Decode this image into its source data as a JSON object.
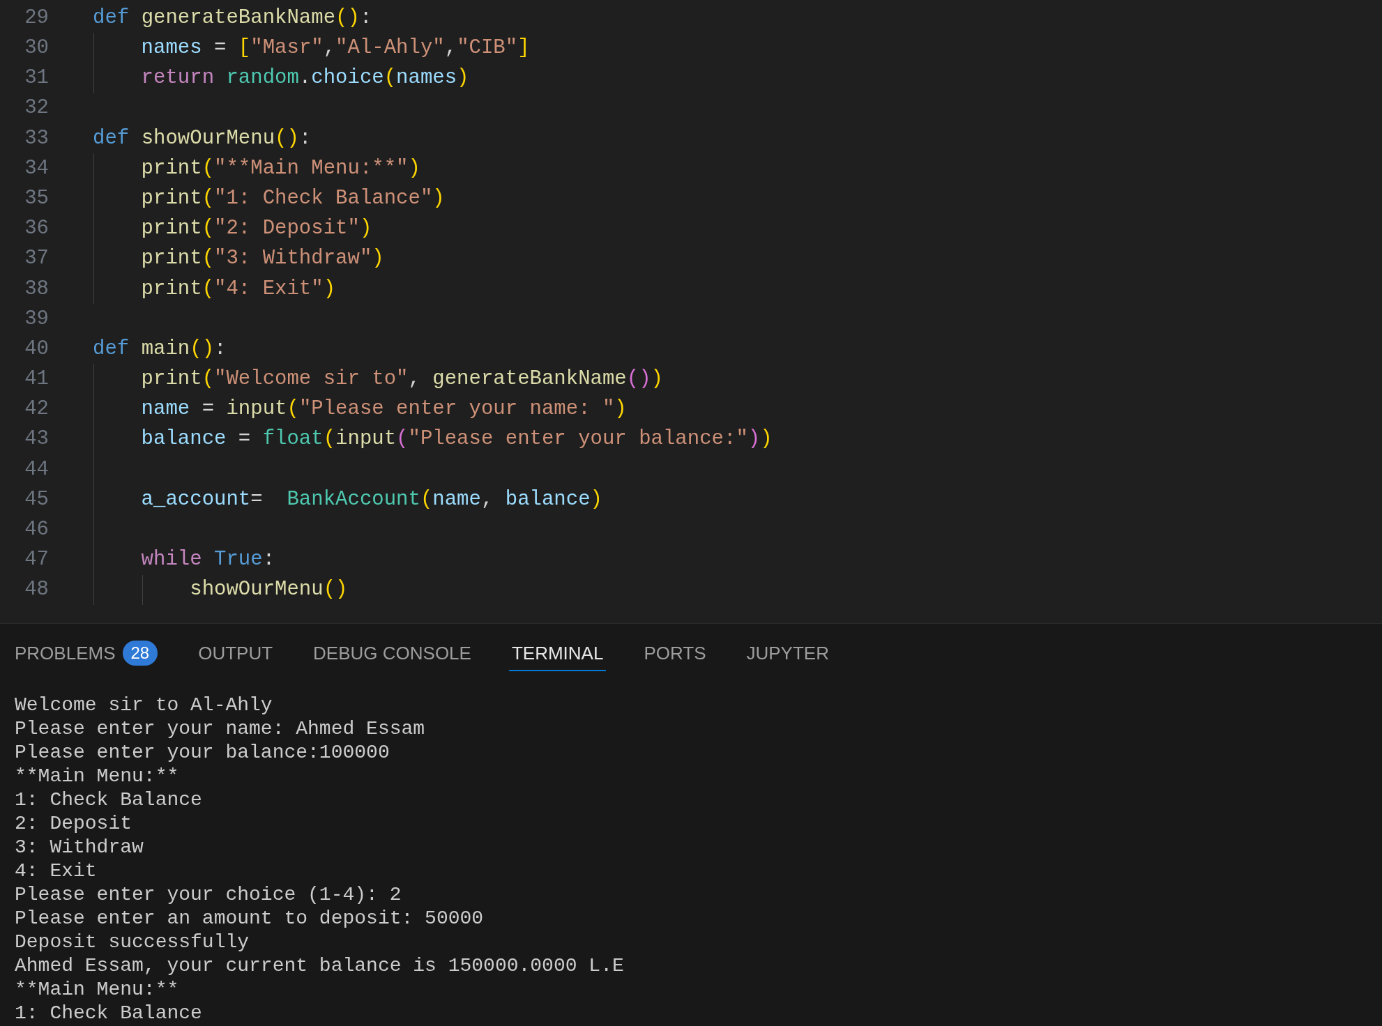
{
  "editor": {
    "lines": [
      {
        "number": "29",
        "tokens": [
          {
            "kind": "kw",
            "text": "def "
          },
          {
            "kind": "fn",
            "text": "generateBankName"
          },
          {
            "kind": "b1",
            "text": "()"
          },
          {
            "kind": "plain",
            "text": ":"
          }
        ]
      },
      {
        "number": "30",
        "tokens": [
          {
            "kind": "var",
            "text": "    names"
          },
          {
            "kind": "plain",
            "text": " = "
          },
          {
            "kind": "b1",
            "text": "["
          },
          {
            "kind": "str",
            "text": "\"Masr\""
          },
          {
            "kind": "plain",
            "text": ","
          },
          {
            "kind": "str",
            "text": "\"Al-Ahly\""
          },
          {
            "kind": "plain",
            "text": ","
          },
          {
            "kind": "str",
            "text": "\"CIB\""
          },
          {
            "kind": "b1",
            "text": "]"
          }
        ]
      },
      {
        "number": "31",
        "tokens": [
          {
            "kind": "ctrl",
            "text": "    return "
          },
          {
            "kind": "cls",
            "text": "random"
          },
          {
            "kind": "plain",
            "text": "."
          },
          {
            "kind": "var",
            "text": "choice"
          },
          {
            "kind": "b1",
            "text": "("
          },
          {
            "kind": "var",
            "text": "names"
          },
          {
            "kind": "b1",
            "text": ")"
          }
        ]
      },
      {
        "number": "32"
      },
      {
        "number": "33",
        "tokens": [
          {
            "kind": "kw",
            "text": "def "
          },
          {
            "kind": "fn",
            "text": "showOurMenu"
          },
          {
            "kind": "b1",
            "text": "()"
          },
          {
            "kind": "plain",
            "text": ":"
          }
        ]
      },
      {
        "number": "34",
        "tokens": [
          {
            "kind": "fn",
            "text": "    print"
          },
          {
            "kind": "b1",
            "text": "("
          },
          {
            "kind": "str",
            "text": "\"**Main Menu:**\""
          },
          {
            "kind": "b1",
            "text": ")"
          }
        ]
      },
      {
        "number": "35",
        "tokens": [
          {
            "kind": "fn",
            "text": "    print"
          },
          {
            "kind": "b1",
            "text": "("
          },
          {
            "kind": "str",
            "text": "\"1: Check Balance\""
          },
          {
            "kind": "b1",
            "text": ")"
          }
        ]
      },
      {
        "number": "36",
        "tokens": [
          {
            "kind": "fn",
            "text": "    print"
          },
          {
            "kind": "b1",
            "text": "("
          },
          {
            "kind": "str",
            "text": "\"2: Deposit\""
          },
          {
            "kind": "b1",
            "text": ")"
          }
        ]
      },
      {
        "number": "37",
        "tokens": [
          {
            "kind": "fn",
            "text": "    print"
          },
          {
            "kind": "b1",
            "text": "("
          },
          {
            "kind": "str",
            "text": "\"3: Withdraw\""
          },
          {
            "kind": "b1",
            "text": ")"
          }
        ]
      },
      {
        "number": "38",
        "tokens": [
          {
            "kind": "fn",
            "text": "    print"
          },
          {
            "kind": "b1",
            "text": "("
          },
          {
            "kind": "str",
            "text": "\"4: Exit\""
          },
          {
            "kind": "b1",
            "text": ")"
          }
        ]
      },
      {
        "number": "39"
      },
      {
        "number": "40",
        "tokens": [
          {
            "kind": "kw",
            "text": "def "
          },
          {
            "kind": "fn",
            "text": "main"
          },
          {
            "kind": "b1",
            "text": "()"
          },
          {
            "kind": "plain",
            "text": ":"
          }
        ]
      },
      {
        "number": "41",
        "tokens": [
          {
            "kind": "fn",
            "text": "    print"
          },
          {
            "kind": "b1",
            "text": "("
          },
          {
            "kind": "str",
            "text": "\"Welcome sir to\""
          },
          {
            "kind": "plain",
            "text": ", "
          },
          {
            "kind": "fn",
            "text": "generateBankName"
          },
          {
            "kind": "b2",
            "text": "()"
          },
          {
            "kind": "b1",
            "text": ")"
          }
        ]
      },
      {
        "number": "42",
        "tokens": [
          {
            "kind": "var",
            "text": "    name"
          },
          {
            "kind": "plain",
            "text": " = "
          },
          {
            "kind": "fn",
            "text": "input"
          },
          {
            "kind": "b1",
            "text": "("
          },
          {
            "kind": "str",
            "text": "\"Please enter your name: \""
          },
          {
            "kind": "b1",
            "text": ")"
          }
        ]
      },
      {
        "number": "43",
        "tokens": [
          {
            "kind": "var",
            "text": "    balance"
          },
          {
            "kind": "plain",
            "text": " = "
          },
          {
            "kind": "cls",
            "text": "float"
          },
          {
            "kind": "b1",
            "text": "("
          },
          {
            "kind": "fn",
            "text": "input"
          },
          {
            "kind": "b2",
            "text": "("
          },
          {
            "kind": "str",
            "text": "\"Please enter your balance:\""
          },
          {
            "kind": "b2",
            "text": ")"
          },
          {
            "kind": "b1",
            "text": ")"
          }
        ]
      },
      {
        "number": "44"
      },
      {
        "number": "45",
        "tokens": [
          {
            "kind": "var",
            "text": "    a_account"
          },
          {
            "kind": "plain",
            "text": "=  "
          },
          {
            "kind": "cls",
            "text": "BankAccount"
          },
          {
            "kind": "b1",
            "text": "("
          },
          {
            "kind": "var",
            "text": "name"
          },
          {
            "kind": "plain",
            "text": ", "
          },
          {
            "kind": "var",
            "text": "balance"
          },
          {
            "kind": "b1",
            "text": ")"
          }
        ]
      },
      {
        "number": "46"
      },
      {
        "number": "47",
        "tokens": [
          {
            "kind": "ctrl",
            "text": "    while "
          },
          {
            "kind": "kw",
            "text": "True"
          },
          {
            "kind": "plain",
            "text": ":"
          }
        ]
      },
      {
        "number": "48",
        "tokens": [
          {
            "kind": "fn",
            "text": "        showOurMenu"
          },
          {
            "kind": "b1",
            "text": "()"
          }
        ]
      }
    ]
  },
  "panel": {
    "tabs": [
      {
        "label": "PROBLEMS",
        "badge": "28",
        "selected": false
      },
      {
        "label": "OUTPUT",
        "selected": false
      },
      {
        "label": "DEBUG CONSOLE",
        "selected": false
      },
      {
        "label": "TERMINAL",
        "selected": true
      },
      {
        "label": "PORTS",
        "selected": false
      },
      {
        "label": "JUPYTER",
        "selected": false
      }
    ],
    "terminal_lines": [
      "Welcome sir to Al-Ahly",
      "Please enter your name: Ahmed Essam",
      "Please enter your balance:100000",
      "**Main Menu:**",
      "1: Check Balance",
      "2: Deposit",
      "3: Withdraw",
      "4: Exit",
      "Please enter your choice (1-4): 2",
      "Please enter an amount to deposit: 50000",
      "Deposit successfully",
      "Ahmed Essam, your current balance is 150000.0000 L.E",
      "**Main Menu:**",
      "1: Check Balance"
    ]
  }
}
